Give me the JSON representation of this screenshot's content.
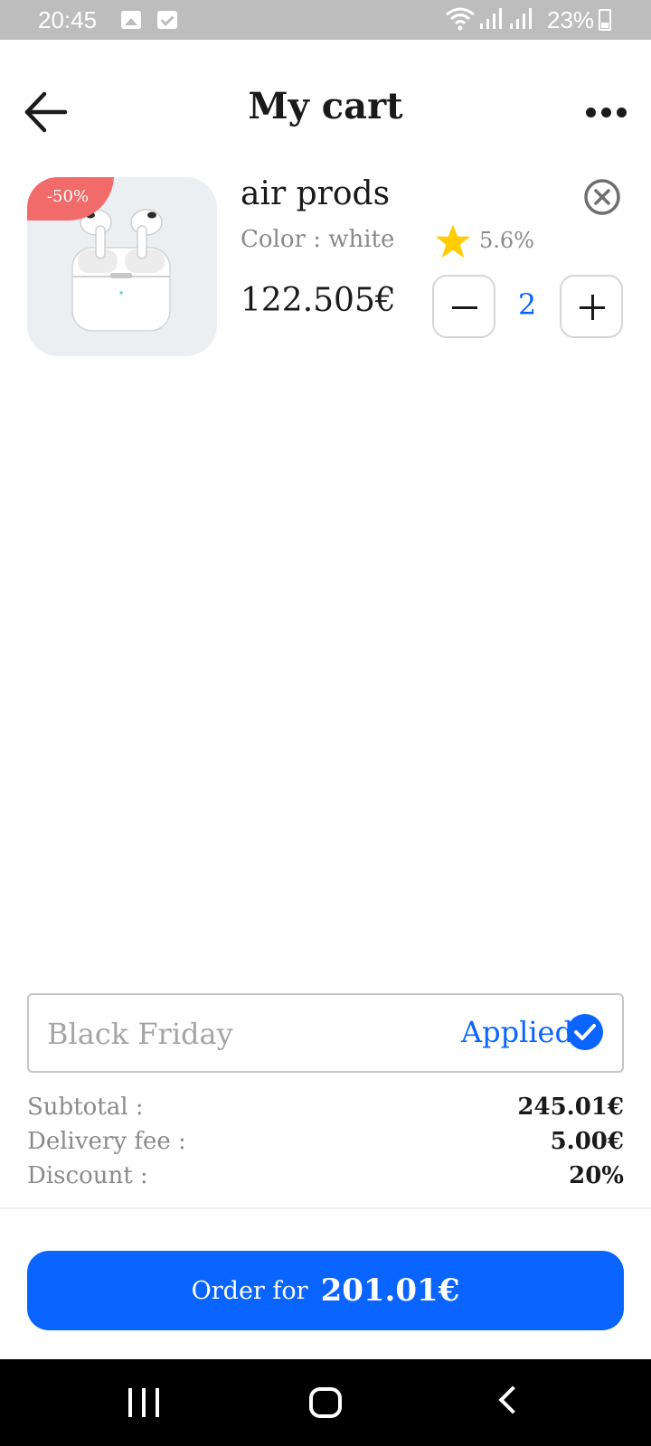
{
  "status_bar": {
    "time": "20:45",
    "battery": "23%",
    "icons": [
      "image-icon",
      "checkbox-icon",
      "wifi-icon",
      "signal-icon",
      "signal-icon",
      "battery-icon"
    ]
  },
  "header": {
    "title": "My cart",
    "back_icon": "arrow-left-icon",
    "more_icon": "more-dots-icon"
  },
  "cart_items": [
    {
      "discount_badge": "-50%",
      "name": "air prods",
      "color": "Color : white",
      "rating": "5.6%",
      "price": "122.505€",
      "quantity": "2",
      "star_color": "#ffcc00"
    }
  ],
  "promo": {
    "code_placeholder": "Black Friday",
    "status": "Applied"
  },
  "summary": {
    "subtotal_label": "Subtotal :",
    "subtotal_value": "245.01€",
    "delivery_label": "Delivery fee :",
    "delivery_value": "5.00€",
    "discount_label": "Discount :",
    "discount_value": "20%"
  },
  "order": {
    "label": "Order for",
    "total": "201.01€"
  },
  "colors": {
    "accent": "#0a64ff",
    "badge": "#f26b6b",
    "muted_text": "#8a8a8a"
  }
}
